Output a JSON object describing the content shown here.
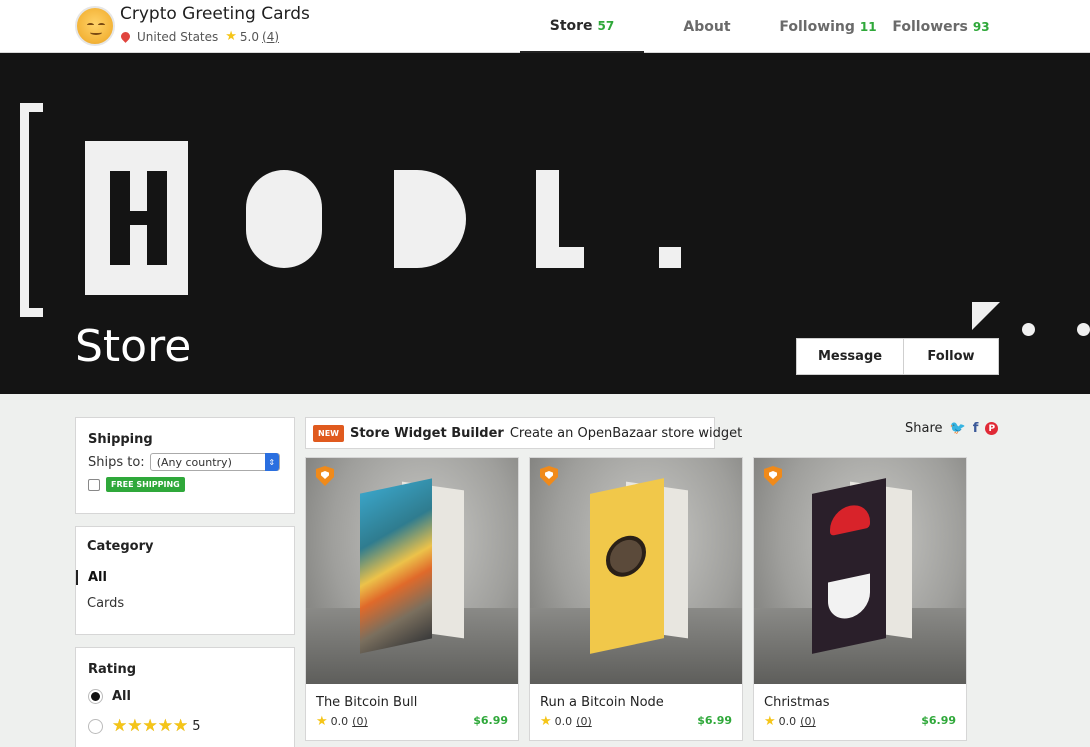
{
  "header": {
    "store_name": "Crypto Greeting Cards",
    "location": "United States",
    "rating": "5.0",
    "rating_count": "(4)"
  },
  "tabs": [
    {
      "label": "Store",
      "count": "57"
    },
    {
      "label": "About",
      "count": ""
    },
    {
      "label": "Following",
      "count": "11"
    },
    {
      "label": "Followers",
      "count": "93"
    }
  ],
  "hero": {
    "title": "Store",
    "message_label": "Message",
    "follow_label": "Follow"
  },
  "filters": {
    "shipping_title": "Shipping",
    "ships_to_label": "Ships to:",
    "ships_to_value": "(Any country)",
    "free_shipping_label": "FREE SHIPPING",
    "category_title": "Category",
    "categories": [
      "All",
      "Cards"
    ],
    "rating_title": "Rating",
    "rating_all": "All",
    "rating_five": "5"
  },
  "widget": {
    "badge": "NEW",
    "title": "Store Widget Builder",
    "description": "Create an OpenBazaar store widget"
  },
  "share": {
    "label": "Share",
    "twitter": "twitter-icon",
    "facebook": "facebook-icon",
    "pinterest": "pinterest-icon"
  },
  "listings": [
    {
      "name": "The Bitcoin Bull",
      "rating": "0.0",
      "rating_count": "(0)",
      "price": "$6.99"
    },
    {
      "name": "Run a Bitcoin Node",
      "rating": "0.0",
      "rating_count": "(0)",
      "price": "$6.99"
    },
    {
      "name": "Christmas",
      "rating": "0.0",
      "rating_count": "(0)",
      "price": "$6.99"
    }
  ],
  "colors": {
    "accent_green": "#2fa83a",
    "new_badge": "#e05a1e",
    "hero_bg": "#141414"
  }
}
